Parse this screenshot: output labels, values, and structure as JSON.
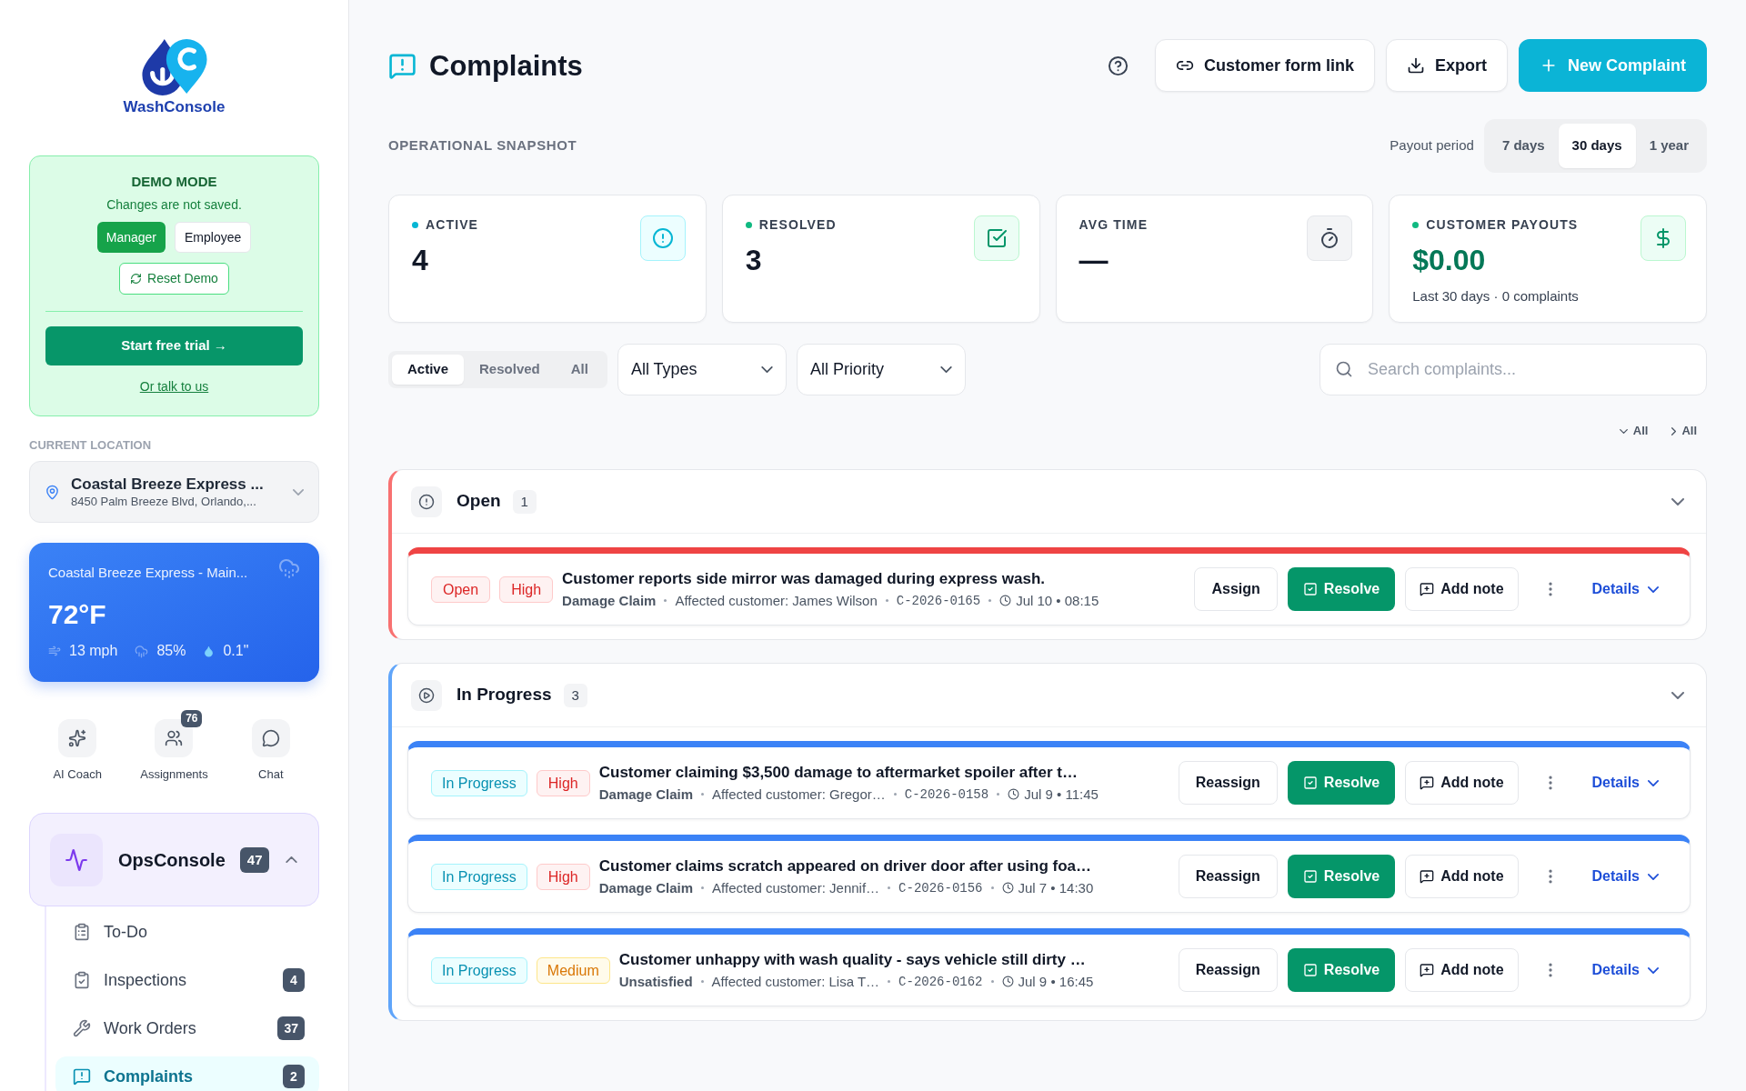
{
  "sidebar": {
    "logo": "WashConsole",
    "demo": {
      "title": "DEMO MODE",
      "note": "Changes are not saved.",
      "roles": [
        {
          "label": "Manager",
          "selected": true
        },
        {
          "label": "Employee",
          "selected": false
        }
      ],
      "reset": "Reset Demo",
      "trial": "Start free trial →",
      "talk": "Or talk to us"
    },
    "location": {
      "label": "CURRENT LOCATION",
      "name": "Coastal Breeze Express ...",
      "address": "8450 Palm Breeze Blvd, Orlando,..."
    },
    "weather": {
      "place": "Coastal Breeze Express - Main...",
      "temperature": "72°F",
      "wind": "13 mph",
      "humidity": "85%",
      "rain": "0.1\""
    },
    "quick_actions": [
      {
        "label": "AI Coach"
      },
      {
        "label": "Assignments",
        "badge": "76"
      },
      {
        "label": "Chat"
      }
    ],
    "section": {
      "title": "OpsConsole",
      "badge": "47",
      "expanded": true,
      "items": [
        {
          "label": "To-Do",
          "selected": false
        },
        {
          "label": "Inspections",
          "badge": "4",
          "selected": false
        },
        {
          "label": "Work Orders",
          "badge": "37",
          "selected": false
        },
        {
          "label": "Complaints",
          "badge": "2",
          "selected": true
        }
      ]
    }
  },
  "header": {
    "title": "Complaints",
    "buttons": [
      {
        "kind": "link",
        "label": "Customer form link"
      },
      {
        "kind": "export",
        "label": "Export"
      },
      {
        "kind": "new",
        "label": "New Complaint"
      }
    ]
  },
  "snapshot": {
    "title": "OPERATIONAL SNAPSHOT",
    "period_label": "Payout period",
    "periods": [
      {
        "label": "7 days",
        "selected": false
      },
      {
        "label": "30 days",
        "selected": true
      },
      {
        "label": "1 year",
        "selected": false
      }
    ]
  },
  "stats": [
    {
      "kind": "active",
      "label": "ACTIVE",
      "value": "4"
    },
    {
      "kind": "resolved",
      "label": "RESOLVED",
      "value": "3"
    },
    {
      "kind": "time",
      "label": "AVG TIME",
      "value": "—"
    },
    {
      "kind": "payouts",
      "label": "CUSTOMER PAYOUTS",
      "value": "$0.00",
      "note": "Last 30 days · 0 complaints"
    }
  ],
  "filters": {
    "tabs": [
      {
        "label": "Active",
        "selected": true
      },
      {
        "label": "Resolved",
        "selected": false
      },
      {
        "label": "All",
        "selected": false
      }
    ],
    "type": "All Types",
    "priority": "All Priority",
    "search_placeholder": "Search complaints..."
  },
  "toggles": [
    {
      "kind": "expand",
      "label": "All"
    },
    {
      "kind": "collapse",
      "label": "All"
    }
  ],
  "groups": [
    {
      "kind": "open",
      "title": "Open",
      "count": "1",
      "expanded": true,
      "complaints": [
        {
          "status": {
            "kind": "open",
            "label": "Open"
          },
          "priority": {
            "kind": "high",
            "label": "High"
          },
          "title": "Customer reports side mirror was damaged during express wash.",
          "type": "Damage Claim",
          "customer": "Affected customer: James Wilson",
          "id": "C-2026-0165",
          "time": "Jul 10 • 08:15",
          "actions": [
            {
              "kind": "assign",
              "label": "Assign"
            },
            {
              "kind": "resolve",
              "label": "Resolve"
            },
            {
              "kind": "note",
              "label": "Add note"
            }
          ],
          "details": "Details"
        }
      ]
    },
    {
      "kind": "in_progress",
      "title": "In Progress",
      "count": "3",
      "expanded": true,
      "complaints": [
        {
          "status": {
            "kind": "in_progress",
            "label": "In Progress"
          },
          "priority": {
            "kind": "high",
            "label": "High"
          },
          "title": "Customer claiming $3,500 damage to aftermarket spoiler after t…",
          "type": "Damage Claim",
          "customer": "Affected customer: Gregor…",
          "id": "C-2026-0158",
          "time": "Jul 9 • 11:45",
          "actions": [
            {
              "kind": "assign",
              "label": "Reassign"
            },
            {
              "kind": "resolve",
              "label": "Resolve"
            },
            {
              "kind": "note",
              "label": "Add note"
            }
          ],
          "details": "Details"
        },
        {
          "status": {
            "kind": "in_progress",
            "label": "In Progress"
          },
          "priority": {
            "kind": "high",
            "label": "High"
          },
          "title": "Customer claims scratch appeared on driver door after using foa…",
          "type": "Damage Claim",
          "customer": "Affected customer: Jennif…",
          "id": "C-2026-0156",
          "time": "Jul 7 • 14:30",
          "actions": [
            {
              "kind": "assign",
              "label": "Reassign"
            },
            {
              "kind": "resolve",
              "label": "Resolve"
            },
            {
              "kind": "note",
              "label": "Add note"
            }
          ],
          "details": "Details"
        },
        {
          "status": {
            "kind": "in_progress",
            "label": "In Progress"
          },
          "priority": {
            "kind": "medium",
            "label": "Medium"
          },
          "title": "Customer unhappy with wash quality - says vehicle still dirty …",
          "type": "Unsatisfied",
          "customer": "Affected customer: Lisa T…",
          "id": "C-2026-0162",
          "time": "Jul 9 • 16:45",
          "actions": [
            {
              "kind": "assign",
              "label": "Reassign"
            },
            {
              "kind": "resolve",
              "label": "Resolve"
            },
            {
              "kind": "note",
              "label": "Add note"
            }
          ],
          "details": "Details"
        }
      ]
    }
  ]
}
